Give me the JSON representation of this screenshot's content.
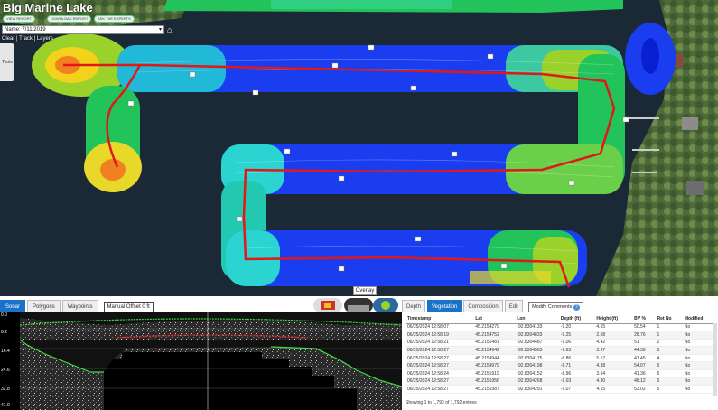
{
  "app": {
    "title": "Big Marine Lake",
    "buttons": [
      "VIEW REPORT",
      "DOWNLOAD REPORT",
      "ASK THE EXPERTS"
    ],
    "name_select": "Name: 7/11/2019",
    "clear_links": [
      "Clear",
      "Track",
      "Layers"
    ],
    "tools_label": "Tools",
    "overlay_label": "Overlay"
  },
  "sonar_panel": {
    "tabs": [
      "Sonar",
      "Polygons",
      "Waypoints"
    ],
    "active_tab": "Sonar",
    "offset_field": "Manual Offset 0 ft",
    "y_labels": [
      "0.0",
      "8.2",
      "16.4",
      "24.6",
      "32.8",
      "41.0"
    ]
  },
  "data_panel": {
    "tabs": [
      "Depth",
      "Vegetation",
      "Composition",
      "Edit"
    ],
    "active_tab": "Vegetation",
    "modify_button": "Modify Comments",
    "modify_help": "?",
    "columns": [
      "Timestamp",
      "Lat",
      "Lon",
      "Depth (ft)",
      "Height (ft)",
      "BV %",
      "Ret No",
      "Modified"
    ],
    "rows": [
      [
        "06/25/2024 12:58:07",
        "45.2154279",
        "-92.8304133",
        "-9.20",
        "4.65",
        "50.54",
        "1",
        "No"
      ],
      [
        "06/25/2024 12:58:19",
        "45.2154752",
        "-92.8304833",
        "-9.25",
        "2.68",
        "28.76",
        "1",
        "No"
      ],
      [
        "06/25/2024 12:58:21",
        "45.2151481",
        "-92.8304487",
        "-9.06",
        "4.42",
        "51",
        "2",
        "No"
      ],
      [
        "06/25/2024 12:58:27",
        "45.2154942",
        "-92.8304563",
        "-9.63",
        "3.97",
        "44.36",
        "3",
        "No"
      ],
      [
        "06/25/2024 12:58:27",
        "45.2154944",
        "-92.8304175",
        "-8.86",
        "5.17",
        "41.45",
        "4",
        "No"
      ],
      [
        "06/25/2024 12:58:27",
        "45.2154979",
        "-92.8304198",
        "-8.71",
        "4.38",
        "54.07",
        "5",
        "No"
      ],
      [
        "06/25/2024 12:58:24",
        "45.2151919",
        "-92.8304152",
        "-8.96",
        "3.54",
        "41.36",
        "5",
        "No"
      ],
      [
        "06/25/2024 12:58:27",
        "45.2151956",
        "-92.8304268",
        "-9.03",
        "4.30",
        "48.12",
        "5",
        "No"
      ],
      [
        "06/25/2024 12:58:27",
        "45.2151987",
        "-92.8304291",
        "-9.07",
        "4.15",
        "53.02",
        "5",
        "No"
      ]
    ],
    "showing": "Showing 1 to 1,792 of 1,792 entries"
  }
}
